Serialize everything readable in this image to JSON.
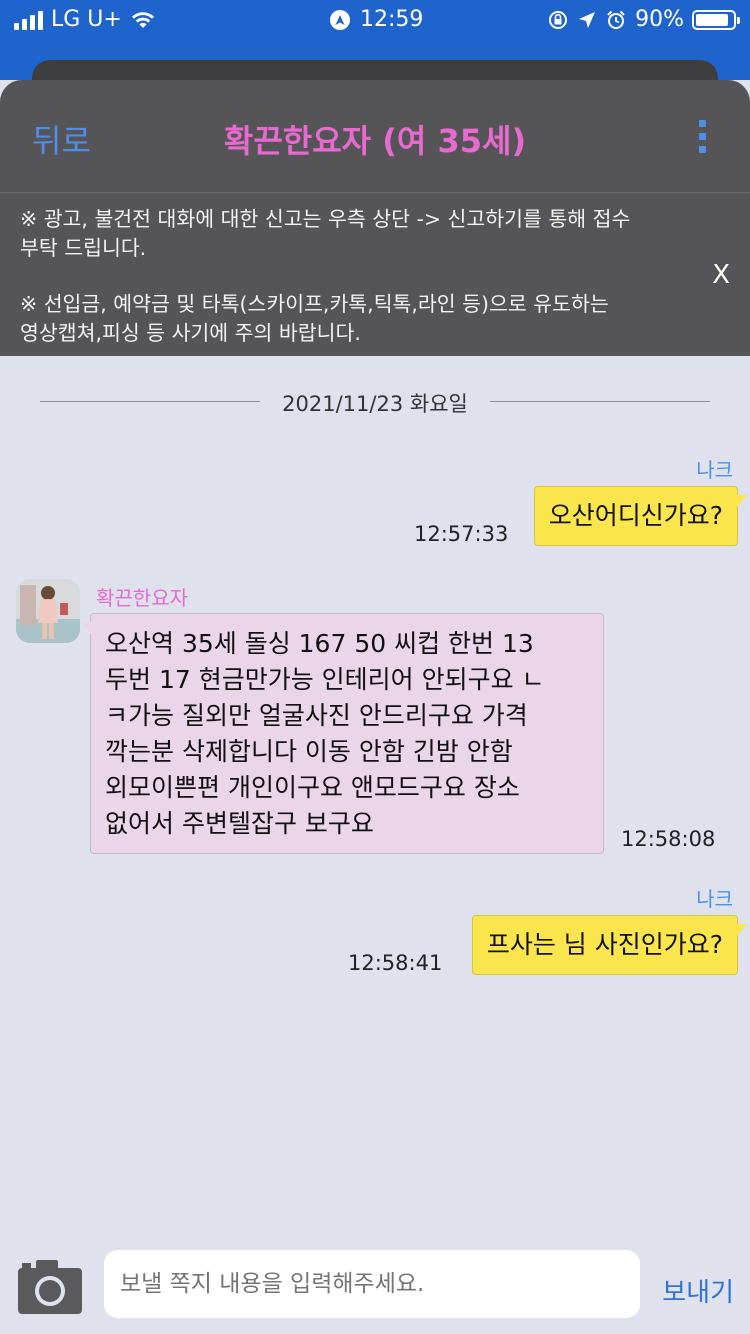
{
  "status_bar": {
    "carrier": "LG U+",
    "time": "12:59",
    "battery": "90%",
    "battery_level": 0.9,
    "icons": [
      "signal-icon",
      "wifi-icon",
      "location-badge-icon",
      "screen-rotation-lock-icon",
      "location-arrow-icon",
      "alarm-icon",
      "battery-icon"
    ]
  },
  "header": {
    "back_label": "뒤로",
    "title": "확끈한요자 (여 35세)",
    "more_icon": "more-vertical-icon",
    "accent_color": "#e86ad0",
    "link_color": "#4f8fea"
  },
  "notice": {
    "line1": "※ 광고, 불건전 대화에 대한 신고는 우측 상단 -> 신고하기를 통해 접수",
    "line2": "부탁 드립니다.",
    "line3": "※ 선입금, 예약금 및 타톡(스카이프,카톡,틱톡,라인 등)으로 유도하는",
    "line4": "영상캡쳐,피싱 등 사기에 주의 바랍니다.",
    "close_label": "X"
  },
  "date_divider": "2021/11/23 화요일",
  "messages": [
    {
      "from": "mine",
      "sender": "나크",
      "text": "오산어디신가요?",
      "time": "12:57:33"
    },
    {
      "from": "other",
      "sender": "확끈한요자",
      "lines": [
        "오산역 35세 돌싱 167 50  씨컵  한번 13",
        "두번 17 현금만가능 인테리어 안되구요 ㄴ",
        "ㅋ가능 질외만  얼굴사진 안드리구요 가격",
        "깍는분 삭제합니다  이동 안함 긴밤  안함",
        "외모이쁜편 개인이구요  앤모드구요 장소",
        "없어서 주변텔잡구 보구요"
      ],
      "time": "12:58:08"
    },
    {
      "from": "mine",
      "sender": "나크",
      "text": "프사는 님 사진인가요?",
      "time": "12:58:41"
    }
  ],
  "composer": {
    "camera_icon": "camera-icon",
    "placeholder": "보낼 쪽지 내용을 입력해주세요.",
    "send_label": "보내기"
  }
}
